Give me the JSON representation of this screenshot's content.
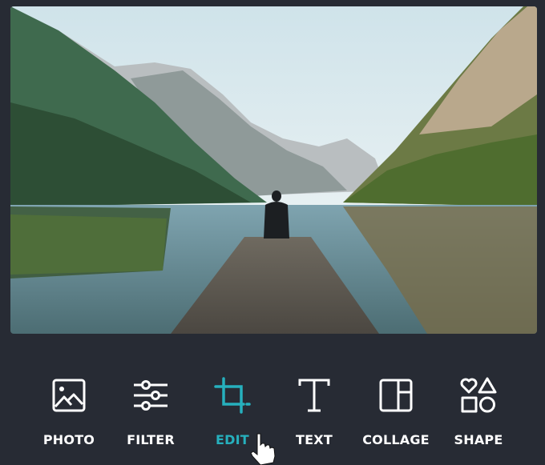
{
  "photo": {
    "description": "Person sitting at end of wooden pier on a mountain lake",
    "alt": "mountain-lake-photo"
  },
  "toolbar": {
    "active_color": "#26b0bd",
    "items": [
      {
        "label": "PHOTO",
        "icon": "image-icon",
        "active": false
      },
      {
        "label": "FILTER",
        "icon": "sliders-icon",
        "active": false
      },
      {
        "label": "EDIT",
        "icon": "crop-icon",
        "active": true
      },
      {
        "label": "TEXT",
        "icon": "text-icon",
        "active": false
      },
      {
        "label": "COLLAGE",
        "icon": "collage-icon",
        "active": false
      },
      {
        "label": "SHAPE",
        "icon": "shapes-icon",
        "active": false
      }
    ]
  },
  "cursor": {
    "icon": "hand-pointer-icon"
  }
}
